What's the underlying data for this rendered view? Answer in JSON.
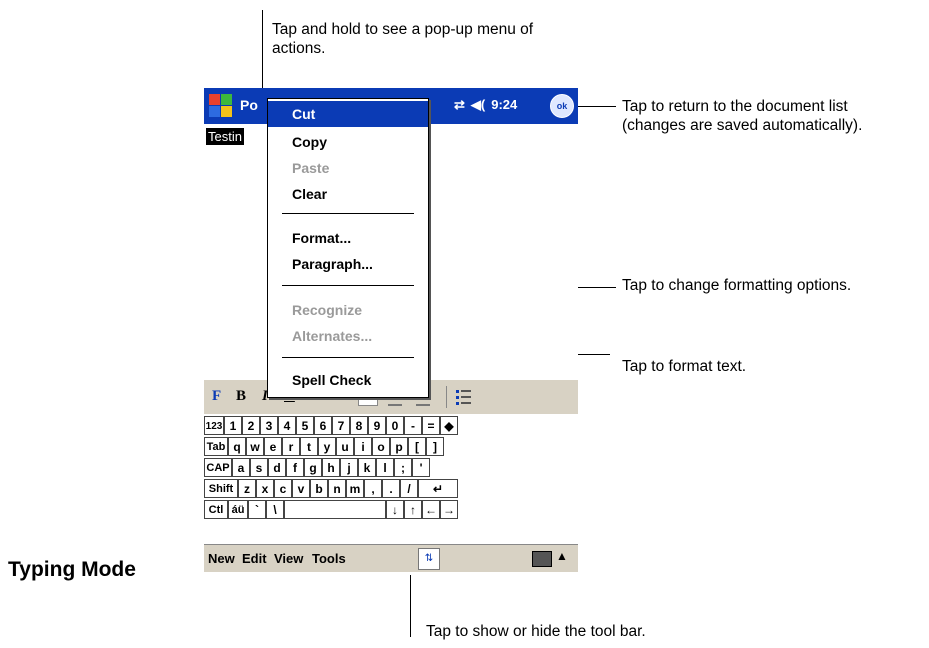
{
  "annotations": {
    "popup_hint_line1": "Tap and hold to see a pop-up menu of",
    "popup_hint_line2": "actions.",
    "return_hint_line1": "Tap to return to the document list",
    "return_hint_line2": "(changes are saved automatically).",
    "format_options_hint": "Tap to change formatting options.",
    "format_text_hint": "Tap to format text.",
    "toolbar_hint": "Tap to show or hide the tool bar.",
    "mode_label": "Typing Mode"
  },
  "titlebar": {
    "title": "Po",
    "time": "9:24",
    "ok_label": "ok"
  },
  "document": {
    "selected_text": "Testin"
  },
  "popup_menu": {
    "items": [
      {
        "label": "Cut",
        "state": "selected"
      },
      {
        "label": "Copy",
        "state": "enabled"
      },
      {
        "label": "Paste",
        "state": "disabled"
      },
      {
        "label": "Clear",
        "state": "enabled"
      },
      {
        "label": "Format...",
        "state": "enabled"
      },
      {
        "label": "Paragraph...",
        "state": "enabled"
      },
      {
        "label": "Recognize",
        "state": "disabled"
      },
      {
        "label": "Alternates...",
        "state": "disabled"
      },
      {
        "label": "Spell Check",
        "state": "enabled"
      }
    ]
  },
  "toolbar": {
    "format_icon": "F",
    "bold": "B",
    "italic": "I",
    "underline": "U"
  },
  "keyboard": {
    "row1": [
      "123",
      "1",
      "2",
      "3",
      "4",
      "5",
      "6",
      "7",
      "8",
      "9",
      "0",
      "-",
      "=",
      "◆"
    ],
    "row2": [
      "Tab",
      "q",
      "w",
      "e",
      "r",
      "t",
      "y",
      "u",
      "i",
      "o",
      "p",
      "[",
      "]"
    ],
    "row3": [
      "CAP",
      "a",
      "s",
      "d",
      "f",
      "g",
      "h",
      "j",
      "k",
      "l",
      ";",
      "'"
    ],
    "row4": [
      "Shift",
      "z",
      "x",
      "c",
      "v",
      "b",
      "n",
      "m",
      ",",
      ".",
      "/",
      "↵"
    ],
    "row5": [
      "Ctl",
      "áü",
      "`",
      "\\",
      "",
      "↓",
      "↑",
      "←",
      "→"
    ]
  },
  "menubar": {
    "new": "New",
    "edit": "Edit",
    "view": "View",
    "tools": "Tools"
  },
  "colors": {
    "titlebar": "#0b3bb5",
    "selection": "#0b3bb5",
    "chrome": "#d8d2c4"
  }
}
